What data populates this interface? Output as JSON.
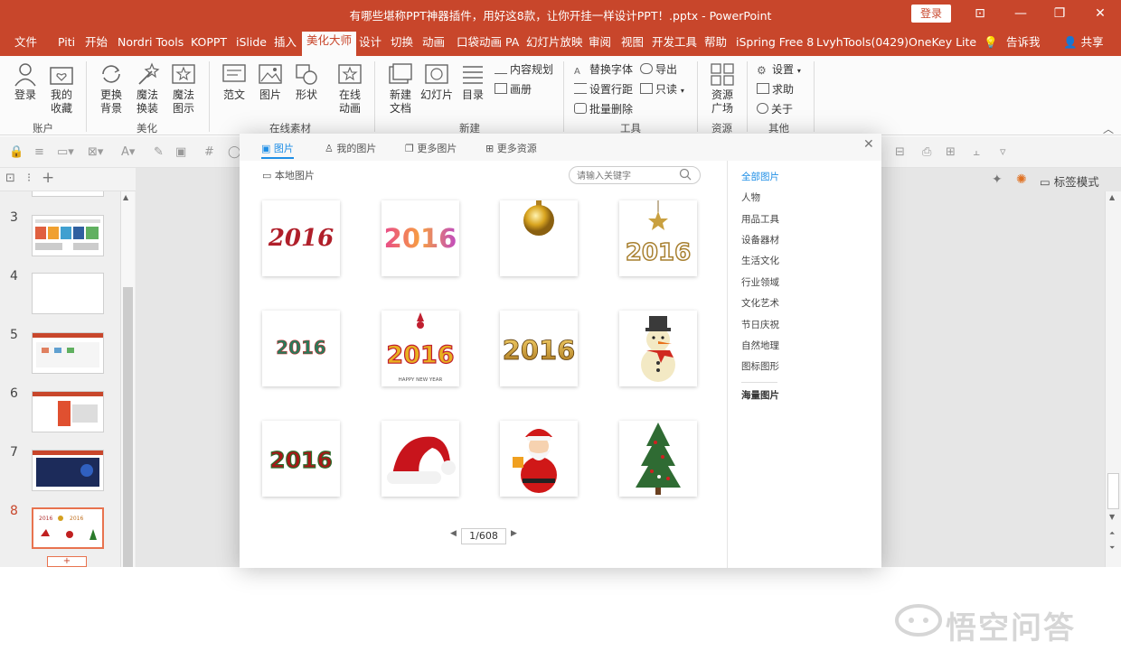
{
  "window": {
    "title": "有哪些堪称PPT神器插件，用好这8款，让你开挂一样设计PPT！.pptx - PowerPoint",
    "login_button": "登录"
  },
  "menu": [
    {
      "label": "文件"
    },
    {
      "label": "Piti"
    },
    {
      "label": "开始"
    },
    {
      "label": "Nordri Tools"
    },
    {
      "label": "KOPPT"
    },
    {
      "label": "iSlide"
    },
    {
      "label": "插入"
    },
    {
      "label": "美化大师"
    },
    {
      "label": "设计"
    },
    {
      "label": "切换"
    },
    {
      "label": "动画"
    },
    {
      "label": "口袋动画 PA"
    },
    {
      "label": "幻灯片放映"
    },
    {
      "label": "审阅"
    },
    {
      "label": "视图"
    },
    {
      "label": "开发工具"
    },
    {
      "label": "帮助"
    },
    {
      "label": "iSpring Free 8"
    },
    {
      "label": "LvyhTools(0429)"
    },
    {
      "label": "OneKey Lite"
    },
    {
      "label": "告诉我"
    },
    {
      "label": "共享"
    }
  ],
  "ribbon": {
    "account": {
      "login": "登录",
      "my_fav_1": "我的",
      "my_fav_2": "收藏",
      "group": "账户"
    },
    "beautify": {
      "bg_1": "更换",
      "bg_2": "背景",
      "magic_1": "魔法",
      "magic_2": "换装",
      "show_1": "魔法",
      "show_2": "图示",
      "group": "美化"
    },
    "online": {
      "template": "范文",
      "picture": "图片",
      "shape": "形状",
      "anim_1": "在线",
      "anim_2": "动画",
      "group": "在线素材"
    },
    "new": {
      "doc_1": "新建",
      "doc_2": "文档",
      "slide": "幻灯片",
      "toc": "目录",
      "content_plan": "内容规划",
      "album": "画册",
      "group": "新建"
    },
    "tools": {
      "replace_font": "替换字体",
      "export": "导出",
      "line_spacing": "设置行距",
      "readonly": "只读",
      "batch_delete": "批量删除",
      "group": "工具"
    },
    "resource": {
      "square_1": "资源",
      "square_2": "广场",
      "group": "资源"
    },
    "other": {
      "settings": "设置",
      "help": "求助",
      "about": "关于",
      "group": "其他"
    }
  },
  "slides": [
    {
      "num": "3"
    },
    {
      "num": "4"
    },
    {
      "num": "5"
    },
    {
      "num": "6"
    },
    {
      "num": "7"
    },
    {
      "num": "8"
    }
  ],
  "side": {
    "tag_mode": "标签模式"
  },
  "dialog": {
    "tabs": [
      {
        "label": "图片"
      },
      {
        "label": "我的图片"
      },
      {
        "label": "更多图片"
      },
      {
        "label": "更多资源"
      }
    ],
    "local_picture": "本地图片",
    "search_placeholder": "请输入关键字",
    "images": [
      {
        "text": "2016",
        "icon": "red-2016-image"
      },
      {
        "text": "2016",
        "icon": "colorful-2016-image"
      },
      {
        "text": "",
        "icon": "golden-ornament-image"
      },
      {
        "text": "2016",
        "icon": "hanging-gold-2016-image"
      },
      {
        "text": "2016",
        "icon": "green-2016-image"
      },
      {
        "text": "HAPPY NEW YEAR",
        "icon": "ribbon-2016-happy-new-year-image"
      },
      {
        "text": "2016",
        "icon": "gold-2016-image"
      },
      {
        "text": "",
        "icon": "snowman-image"
      },
      {
        "text": "2016",
        "icon": "christmas-2016-image"
      },
      {
        "text": "",
        "icon": "santa-hat-image"
      },
      {
        "text": "",
        "icon": "santa-claus-image"
      },
      {
        "text": "",
        "icon": "christmas-tree-image"
      }
    ],
    "page": "1/608",
    "categories": [
      {
        "label": "全部图片"
      },
      {
        "label": "人物"
      },
      {
        "label": "用品工具"
      },
      {
        "label": "设备器材"
      },
      {
        "label": "生活文化"
      },
      {
        "label": "行业领域"
      },
      {
        "label": "文化艺术"
      },
      {
        "label": "节日庆祝"
      },
      {
        "label": "自然地理"
      },
      {
        "label": "图标图形"
      },
      {
        "label": "海量图片"
      }
    ]
  },
  "watermark": "悟空问答",
  "colors": {
    "accent": "#c8462b",
    "link": "#1e8ee6"
  }
}
